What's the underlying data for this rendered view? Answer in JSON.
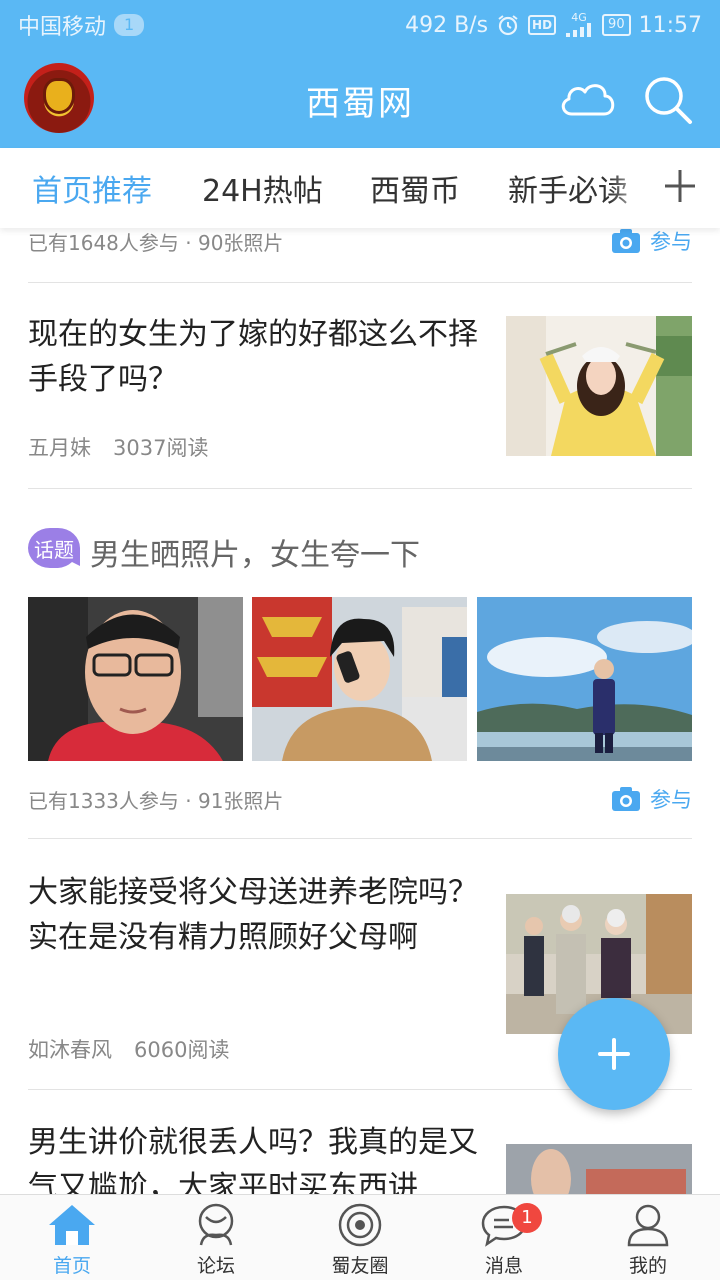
{
  "status_bar": {
    "carrier": "中国移动",
    "sim_badge": "1",
    "speed": "492 B/s",
    "hd": "HD",
    "network": "4G",
    "battery": "90",
    "time": "11:57"
  },
  "header": {
    "title": "西蜀网"
  },
  "tabs": {
    "items": [
      "首页推荐",
      "24H热帖",
      "西蜀币",
      "新手必读"
    ],
    "active_index": 0
  },
  "feed": {
    "top_meta": {
      "text": "已有1648人参与 · 90张照片",
      "join_label": "参与"
    },
    "article1": {
      "title": "现在的女生为了嫁的好都这么不择手段了吗？",
      "author": "五月妹",
      "reads": "3037阅读"
    },
    "topic": {
      "badge": "话题",
      "title": "男生晒照片，女生夸一下",
      "meta": "已有1333人参与 · 91张照片",
      "join_label": "参与"
    },
    "article2": {
      "title": "大家能接受将父母送进养老院吗？实在是没有精力照顾好父母啊",
      "author": "如沐春风",
      "reads": "6060阅读"
    },
    "article3": {
      "title": "男生讲价就很丢人吗？我真的是又气又尴尬，大家平时买东西讲"
    }
  },
  "bottom_nav": {
    "items": [
      {
        "label": "首页",
        "icon": "home-icon"
      },
      {
        "label": "论坛",
        "icon": "forum-icon"
      },
      {
        "label": "蜀友圈",
        "icon": "circle-icon"
      },
      {
        "label": "消息",
        "icon": "message-icon",
        "badge": "1"
      },
      {
        "label": "我的",
        "icon": "profile-icon"
      }
    ],
    "active_index": 0
  },
  "colors": {
    "brand": "#5ab8f4",
    "accent": "#4aa8f0",
    "badge": "#f0473f",
    "topic": "#9b7fe6"
  }
}
